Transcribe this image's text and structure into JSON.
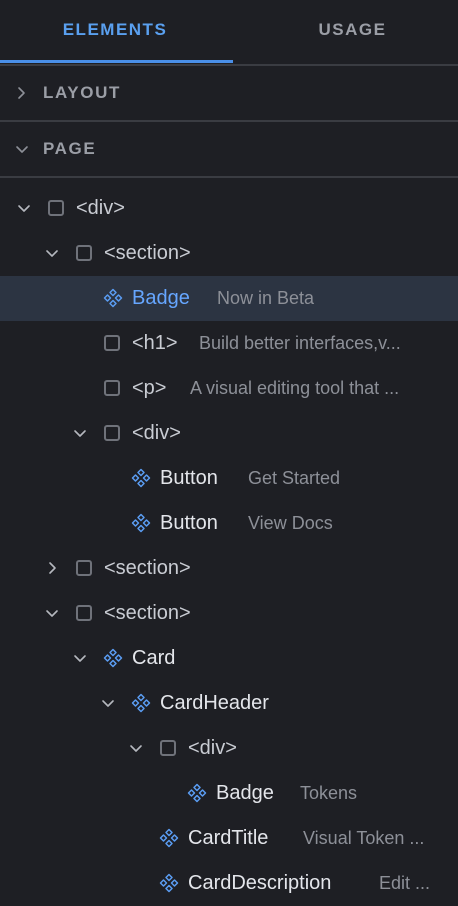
{
  "tabs": [
    {
      "label": "ELEMENTS",
      "active": true
    },
    {
      "label": "USAGE",
      "active": false
    }
  ],
  "sections": {
    "layout": {
      "label": "LAYOUT",
      "expanded": false
    },
    "page": {
      "label": "PAGE",
      "expanded": true
    }
  },
  "tree": [
    {
      "name": "<div>",
      "kind": "element",
      "expanded": true,
      "description": ""
    },
    {
      "name": "<section>",
      "kind": "element",
      "expanded": true,
      "description": ""
    },
    {
      "name": "Badge",
      "kind": "component",
      "selected": true,
      "description": "Now in Beta"
    },
    {
      "name": "<h1>",
      "kind": "element",
      "description": "Build better interfaces,v..."
    },
    {
      "name": "<p>",
      "kind": "element",
      "description": "A visual editing tool that ..."
    },
    {
      "name": "<div>",
      "kind": "element",
      "expanded": true,
      "description": ""
    },
    {
      "name": "Button",
      "kind": "component",
      "description": "Get Started"
    },
    {
      "name": "Button",
      "kind": "component",
      "description": "View Docs"
    },
    {
      "name": "<section>",
      "kind": "element",
      "expanded": false,
      "description": ""
    },
    {
      "name": "<section>",
      "kind": "element",
      "expanded": true,
      "description": ""
    },
    {
      "name": "Card",
      "kind": "component",
      "expanded": true,
      "description": ""
    },
    {
      "name": "CardHeader",
      "kind": "component",
      "expanded": true,
      "description": ""
    },
    {
      "name": "<div>",
      "kind": "element",
      "expanded": true,
      "description": ""
    },
    {
      "name": "Badge",
      "kind": "component",
      "description": "Tokens"
    },
    {
      "name": "CardTitle",
      "kind": "component",
      "description": "Visual Token ..."
    },
    {
      "name": "CardDescription",
      "kind": "component",
      "description": "Edit ..."
    }
  ],
  "colors": {
    "background": "#1e1f24",
    "accent": "#4a8fe8",
    "component_icon": "#5a9cf2",
    "selected_row": "#2c3442"
  },
  "icons": {
    "collapsed": "chevron-right-icon",
    "expanded": "chevron-down-icon",
    "element": "checkbox-icon",
    "component": "component-diamond-icon"
  }
}
